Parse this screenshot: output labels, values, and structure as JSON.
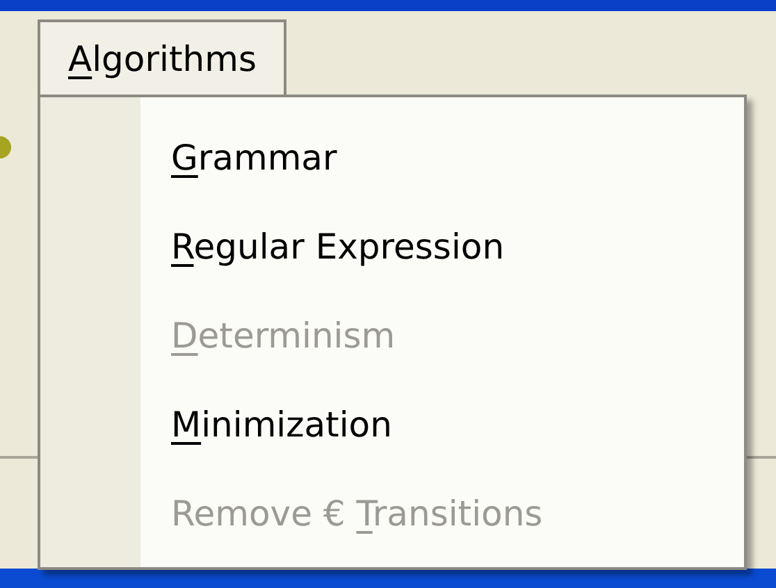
{
  "menu_bar": [
    {
      "key": "A",
      "after": "lgorithms",
      "selected": true
    }
  ],
  "menu_items": [
    {
      "key": "G",
      "after": "rammar",
      "disabled": false
    },
    {
      "key": "R",
      "after": "egular Expression",
      "disabled": false
    },
    {
      "key": "D",
      "after": "eterminism",
      "disabled": true
    },
    {
      "key": "M",
      "after": "inimization",
      "disabled": false
    },
    {
      "before": "Remove € ",
      "key": "T",
      "after": "ransitions",
      "disabled": true
    }
  ]
}
